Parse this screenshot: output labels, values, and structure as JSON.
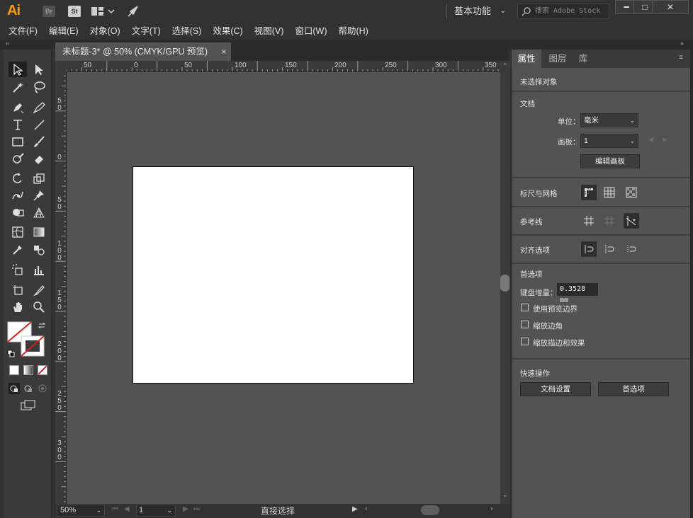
{
  "app": {
    "logo": "Ai",
    "bridge": "Br",
    "stock": "St",
    "workspace": "基本功能",
    "search_placeholder": "搜索 Adobe Stock"
  },
  "menu": [
    "文件(F)",
    "编辑(E)",
    "对象(O)",
    "文字(T)",
    "选择(S)",
    "效果(C)",
    "视图(V)",
    "窗口(W)",
    "帮助(H)"
  ],
  "document": {
    "tab_title": "未标题-3* @ 50% (CMYK/GPU 预览)",
    "close": "×"
  },
  "rulers": {
    "h": [
      "50",
      "0",
      "50",
      "100",
      "150",
      "200",
      "250",
      "300",
      "350"
    ],
    "v": [
      "50",
      "0",
      "50",
      "100",
      "150",
      "200",
      "250",
      "300"
    ]
  },
  "status": {
    "zoom": "50%",
    "artboard": "1",
    "tool": "直接选择"
  },
  "panel": {
    "tabs": [
      "属性",
      "图层",
      "库"
    ],
    "no_selection": "未选择对象",
    "document_section": "文档",
    "unit_label": "单位：",
    "unit_value": "毫米",
    "artboard_label": "画板：",
    "artboard_value": "1",
    "edit_artboard": "编辑画板",
    "rulers_grids": "标尺与网格",
    "guides": "参考线",
    "align_options": "对齐选项",
    "preferences": "首选项",
    "keyboard_increment_label": "键盘增量：",
    "keyboard_increment_value": "0.3528 mm",
    "cb_preview_bounds": "使用预览边界",
    "cb_scale_corners": "缩放边角",
    "cb_scale_strokes": "缩放描边和效果",
    "quick_actions": "快速操作",
    "doc_setup": "文档设置",
    "prefs_button": "首选项"
  },
  "colors": {
    "accent": "#ff9a00",
    "canvas": "#535353",
    "panel": "#535353",
    "chrome": "#323232"
  }
}
